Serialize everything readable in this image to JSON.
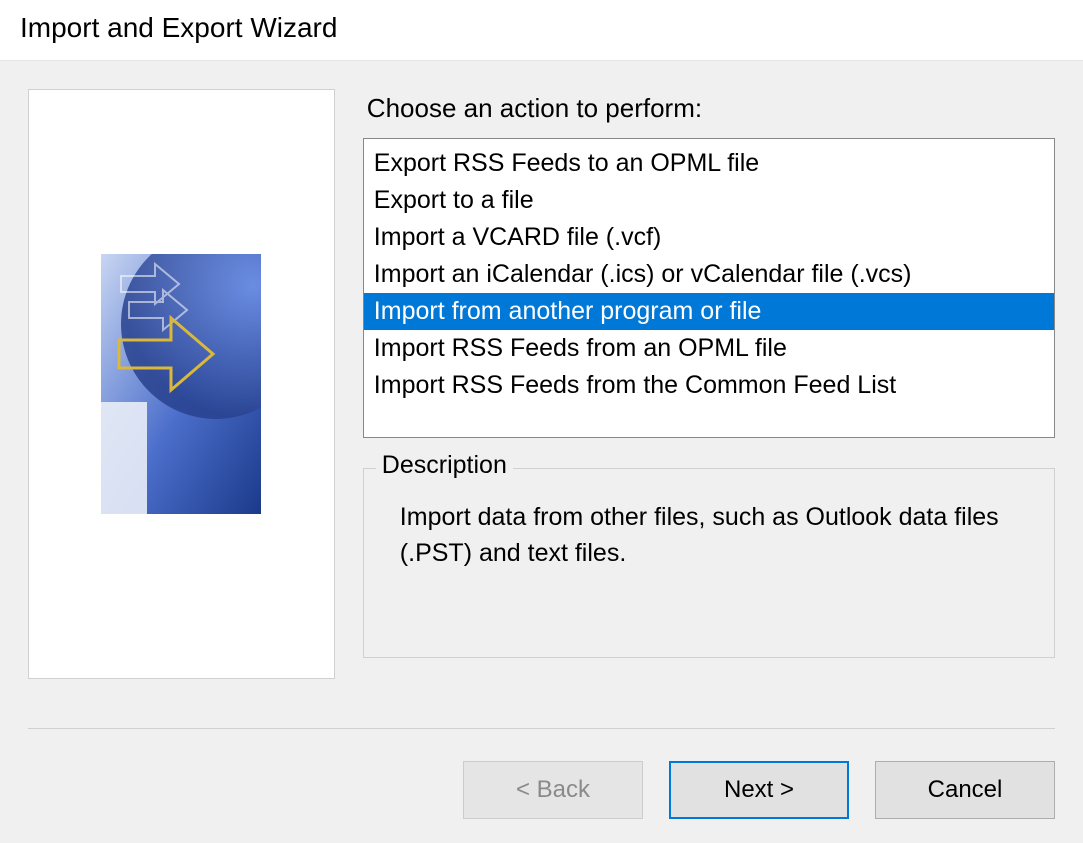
{
  "window_title": "Import and Export Wizard",
  "prompt": "Choose an action to perform:",
  "actions": [
    {
      "label": "Export RSS Feeds to an OPML file",
      "selected": false
    },
    {
      "label": "Export to a file",
      "selected": false
    },
    {
      "label": "Import a VCARD file (.vcf)",
      "selected": false
    },
    {
      "label": "Import an iCalendar (.ics) or vCalendar file (.vcs)",
      "selected": false
    },
    {
      "label": "Import from another program or file",
      "selected": true
    },
    {
      "label": "Import RSS Feeds from an OPML file",
      "selected": false
    },
    {
      "label": "Import RSS Feeds from the Common Feed List",
      "selected": false
    }
  ],
  "description_group_label": "Description",
  "description_text": "Import data from other files, such as Outlook data files (.PST) and text files.",
  "buttons": {
    "back": "< Back",
    "next": "Next >",
    "cancel": "Cancel"
  }
}
